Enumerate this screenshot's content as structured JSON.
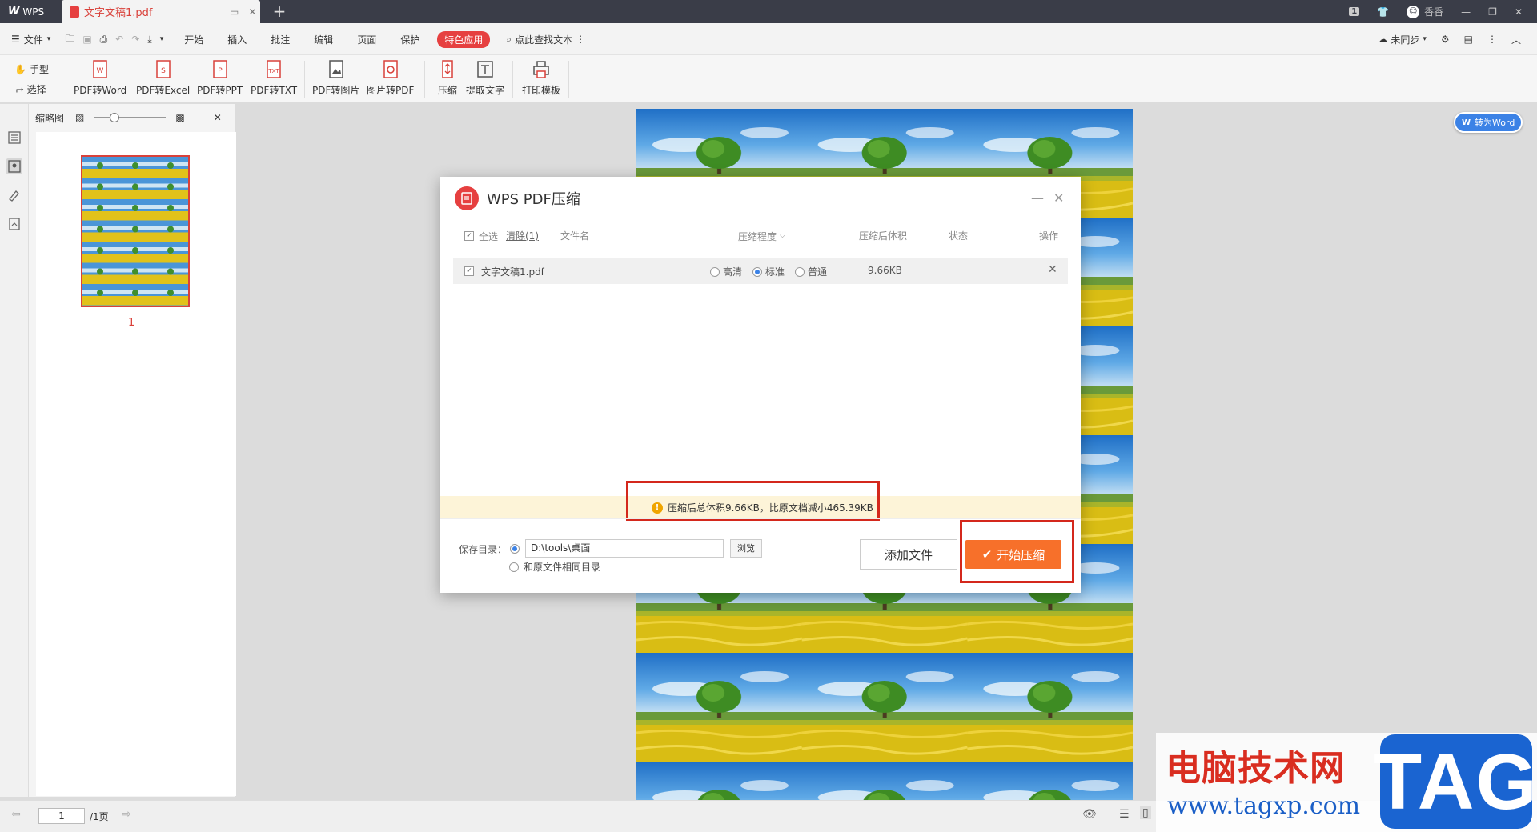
{
  "titlebar": {
    "app_name": "WPS",
    "tab_name": "文字文稿1.pdf",
    "new_tab": "+",
    "badge": "1",
    "user": "香香"
  },
  "menu": {
    "file": "文件",
    "items": [
      "开始",
      "插入",
      "批注",
      "编辑",
      "页面",
      "保护"
    ],
    "special": "特色应用",
    "search": "点此查找文本",
    "sync": "未同步"
  },
  "ribbon": {
    "hand": "手型",
    "select": "选择",
    "tools": [
      "PDF转Word",
      "PDF转Excel",
      "PDF转PPT",
      "PDF转TXT",
      "PDF转图片",
      "图片转PDF",
      "压缩",
      "提取文字",
      "打印模板"
    ]
  },
  "thumbnail": {
    "title": "缩略图",
    "page_number": "1"
  },
  "to_word": "转为Word",
  "statusbar": {
    "page_current": "1",
    "page_total": "/1页"
  },
  "dialog": {
    "title": "WPS PDF压缩",
    "header": {
      "select_all": "全选",
      "clear": "清除(1)",
      "filename": "文件名",
      "level": "压缩程度",
      "size_after": "压缩后体积",
      "status": "状态",
      "action": "操作"
    },
    "row": {
      "filename": "文字文稿1.pdf",
      "options": [
        "高清",
        "标准",
        "普通"
      ],
      "selected": "标准",
      "size": "9.66KB"
    },
    "notice": "压缩后总体积9.66KB，比原文档减小465.39KB",
    "save_label": "保存目录：",
    "save_path": "D:\\tools\\桌面",
    "browse": "浏览",
    "same_dir": "和原文件相同目录",
    "add_file": "添加文件",
    "start": "开始压缩"
  },
  "watermark": {
    "site_name": "电脑技术网",
    "url": "www.tagxp.com",
    "tag": "TAG"
  },
  "colors": {
    "titlebar_bg": "#3a3d48",
    "accent_red": "#e64040",
    "start_orange": "#f7702a",
    "highlight_box": "#d4281c",
    "word_blue": "#3b82e6",
    "notice_bg": "#fdf4d8"
  }
}
